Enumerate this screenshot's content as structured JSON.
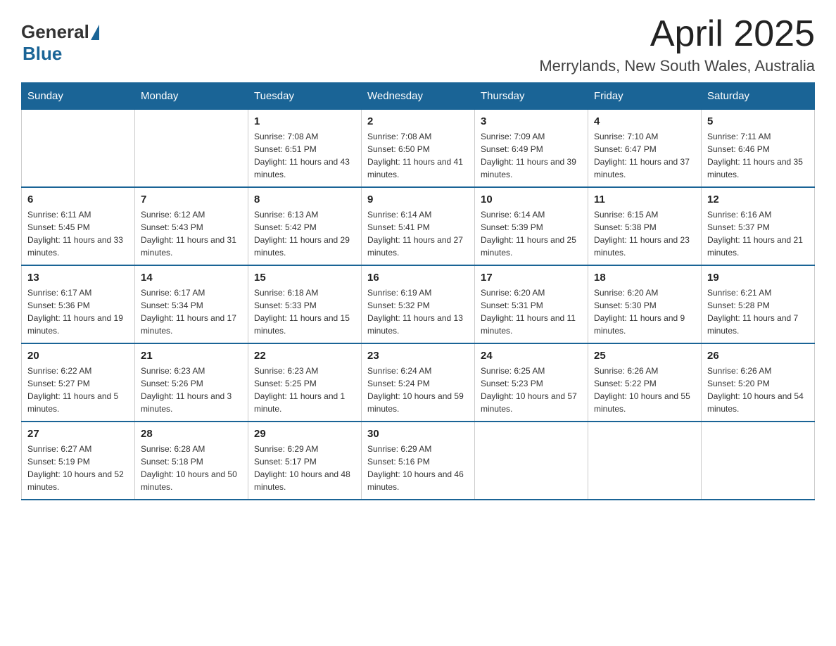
{
  "header": {
    "logo_general": "General",
    "logo_blue": "Blue",
    "month_title": "April 2025",
    "location": "Merrylands, New South Wales, Australia"
  },
  "weekdays": [
    "Sunday",
    "Monday",
    "Tuesday",
    "Wednesday",
    "Thursday",
    "Friday",
    "Saturday"
  ],
  "weeks": [
    [
      {
        "day": "",
        "sunrise": "",
        "sunset": "",
        "daylight": ""
      },
      {
        "day": "",
        "sunrise": "",
        "sunset": "",
        "daylight": ""
      },
      {
        "day": "1",
        "sunrise": "Sunrise: 7:08 AM",
        "sunset": "Sunset: 6:51 PM",
        "daylight": "Daylight: 11 hours and 43 minutes."
      },
      {
        "day": "2",
        "sunrise": "Sunrise: 7:08 AM",
        "sunset": "Sunset: 6:50 PM",
        "daylight": "Daylight: 11 hours and 41 minutes."
      },
      {
        "day": "3",
        "sunrise": "Sunrise: 7:09 AM",
        "sunset": "Sunset: 6:49 PM",
        "daylight": "Daylight: 11 hours and 39 minutes."
      },
      {
        "day": "4",
        "sunrise": "Sunrise: 7:10 AM",
        "sunset": "Sunset: 6:47 PM",
        "daylight": "Daylight: 11 hours and 37 minutes."
      },
      {
        "day": "5",
        "sunrise": "Sunrise: 7:11 AM",
        "sunset": "Sunset: 6:46 PM",
        "daylight": "Daylight: 11 hours and 35 minutes."
      }
    ],
    [
      {
        "day": "6",
        "sunrise": "Sunrise: 6:11 AM",
        "sunset": "Sunset: 5:45 PM",
        "daylight": "Daylight: 11 hours and 33 minutes."
      },
      {
        "day": "7",
        "sunrise": "Sunrise: 6:12 AM",
        "sunset": "Sunset: 5:43 PM",
        "daylight": "Daylight: 11 hours and 31 minutes."
      },
      {
        "day": "8",
        "sunrise": "Sunrise: 6:13 AM",
        "sunset": "Sunset: 5:42 PM",
        "daylight": "Daylight: 11 hours and 29 minutes."
      },
      {
        "day": "9",
        "sunrise": "Sunrise: 6:14 AM",
        "sunset": "Sunset: 5:41 PM",
        "daylight": "Daylight: 11 hours and 27 minutes."
      },
      {
        "day": "10",
        "sunrise": "Sunrise: 6:14 AM",
        "sunset": "Sunset: 5:39 PM",
        "daylight": "Daylight: 11 hours and 25 minutes."
      },
      {
        "day": "11",
        "sunrise": "Sunrise: 6:15 AM",
        "sunset": "Sunset: 5:38 PM",
        "daylight": "Daylight: 11 hours and 23 minutes."
      },
      {
        "day": "12",
        "sunrise": "Sunrise: 6:16 AM",
        "sunset": "Sunset: 5:37 PM",
        "daylight": "Daylight: 11 hours and 21 minutes."
      }
    ],
    [
      {
        "day": "13",
        "sunrise": "Sunrise: 6:17 AM",
        "sunset": "Sunset: 5:36 PM",
        "daylight": "Daylight: 11 hours and 19 minutes."
      },
      {
        "day": "14",
        "sunrise": "Sunrise: 6:17 AM",
        "sunset": "Sunset: 5:34 PM",
        "daylight": "Daylight: 11 hours and 17 minutes."
      },
      {
        "day": "15",
        "sunrise": "Sunrise: 6:18 AM",
        "sunset": "Sunset: 5:33 PM",
        "daylight": "Daylight: 11 hours and 15 minutes."
      },
      {
        "day": "16",
        "sunrise": "Sunrise: 6:19 AM",
        "sunset": "Sunset: 5:32 PM",
        "daylight": "Daylight: 11 hours and 13 minutes."
      },
      {
        "day": "17",
        "sunrise": "Sunrise: 6:20 AM",
        "sunset": "Sunset: 5:31 PM",
        "daylight": "Daylight: 11 hours and 11 minutes."
      },
      {
        "day": "18",
        "sunrise": "Sunrise: 6:20 AM",
        "sunset": "Sunset: 5:30 PM",
        "daylight": "Daylight: 11 hours and 9 minutes."
      },
      {
        "day": "19",
        "sunrise": "Sunrise: 6:21 AM",
        "sunset": "Sunset: 5:28 PM",
        "daylight": "Daylight: 11 hours and 7 minutes."
      }
    ],
    [
      {
        "day": "20",
        "sunrise": "Sunrise: 6:22 AM",
        "sunset": "Sunset: 5:27 PM",
        "daylight": "Daylight: 11 hours and 5 minutes."
      },
      {
        "day": "21",
        "sunrise": "Sunrise: 6:23 AM",
        "sunset": "Sunset: 5:26 PM",
        "daylight": "Daylight: 11 hours and 3 minutes."
      },
      {
        "day": "22",
        "sunrise": "Sunrise: 6:23 AM",
        "sunset": "Sunset: 5:25 PM",
        "daylight": "Daylight: 11 hours and 1 minute."
      },
      {
        "day": "23",
        "sunrise": "Sunrise: 6:24 AM",
        "sunset": "Sunset: 5:24 PM",
        "daylight": "Daylight: 10 hours and 59 minutes."
      },
      {
        "day": "24",
        "sunrise": "Sunrise: 6:25 AM",
        "sunset": "Sunset: 5:23 PM",
        "daylight": "Daylight: 10 hours and 57 minutes."
      },
      {
        "day": "25",
        "sunrise": "Sunrise: 6:26 AM",
        "sunset": "Sunset: 5:22 PM",
        "daylight": "Daylight: 10 hours and 55 minutes."
      },
      {
        "day": "26",
        "sunrise": "Sunrise: 6:26 AM",
        "sunset": "Sunset: 5:20 PM",
        "daylight": "Daylight: 10 hours and 54 minutes."
      }
    ],
    [
      {
        "day": "27",
        "sunrise": "Sunrise: 6:27 AM",
        "sunset": "Sunset: 5:19 PM",
        "daylight": "Daylight: 10 hours and 52 minutes."
      },
      {
        "day": "28",
        "sunrise": "Sunrise: 6:28 AM",
        "sunset": "Sunset: 5:18 PM",
        "daylight": "Daylight: 10 hours and 50 minutes."
      },
      {
        "day": "29",
        "sunrise": "Sunrise: 6:29 AM",
        "sunset": "Sunset: 5:17 PM",
        "daylight": "Daylight: 10 hours and 48 minutes."
      },
      {
        "day": "30",
        "sunrise": "Sunrise: 6:29 AM",
        "sunset": "Sunset: 5:16 PM",
        "daylight": "Daylight: 10 hours and 46 minutes."
      },
      {
        "day": "",
        "sunrise": "",
        "sunset": "",
        "daylight": ""
      },
      {
        "day": "",
        "sunrise": "",
        "sunset": "",
        "daylight": ""
      },
      {
        "day": "",
        "sunrise": "",
        "sunset": "",
        "daylight": ""
      }
    ]
  ]
}
